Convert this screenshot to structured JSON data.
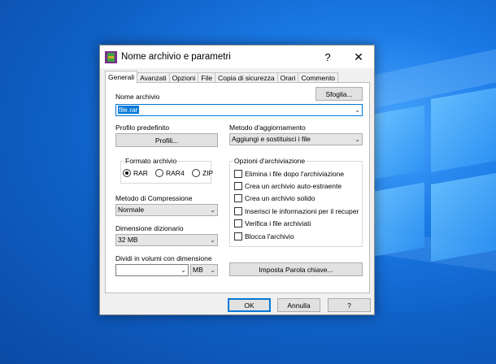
{
  "dialog": {
    "title": "Nome archivio e parametri",
    "help_glyph": "?",
    "close_glyph": "✕"
  },
  "tabs": [
    {
      "label": "Generali",
      "active": true
    },
    {
      "label": "Avanzati"
    },
    {
      "label": "Opzioni"
    },
    {
      "label": "File"
    },
    {
      "label": "Copia di sicurezza"
    },
    {
      "label": "Orari"
    },
    {
      "label": "Commento"
    }
  ],
  "general": {
    "archive_name_label": "Nome archivio",
    "browse_button": "Sfoglia...",
    "archive_name_value": "file.rar",
    "default_profile_label": "Profilo predefinito",
    "profiles_button": "Profili...",
    "update_method_label": "Metodo d'aggiornamento",
    "update_method_value": "Aggiungi e sostituisci i file",
    "archive_format": {
      "title": "Formato archivio",
      "options": [
        "RAR",
        "RAR4",
        "ZIP"
      ],
      "selected": "RAR"
    },
    "compression_method_label": "Metodo di Compressione",
    "compression_method_value": "Normale",
    "dictionary_size_label": "Dimensione dizionario",
    "dictionary_size_value": "32 MB",
    "split_volumes_label": "Dividi in volumi con dimensione",
    "split_volumes_value": "",
    "split_unit_value": "MB",
    "set_password_button": "Imposta Parola chiave...",
    "archiving_options": {
      "title": "Opzioni d'archiviazione",
      "items": [
        "Elimina i file dopo l'archiviazione",
        "Crea un archivio auto-estraente",
        "Crea un archivio solido",
        "Inserisci le informazioni per il recuper",
        "Verifica i file archiviati",
        "Blocca l'archivio"
      ]
    }
  },
  "footer": {
    "ok": "OK",
    "cancel": "Annulla",
    "help": "?"
  },
  "icons": {
    "dropdown": "⌄"
  }
}
